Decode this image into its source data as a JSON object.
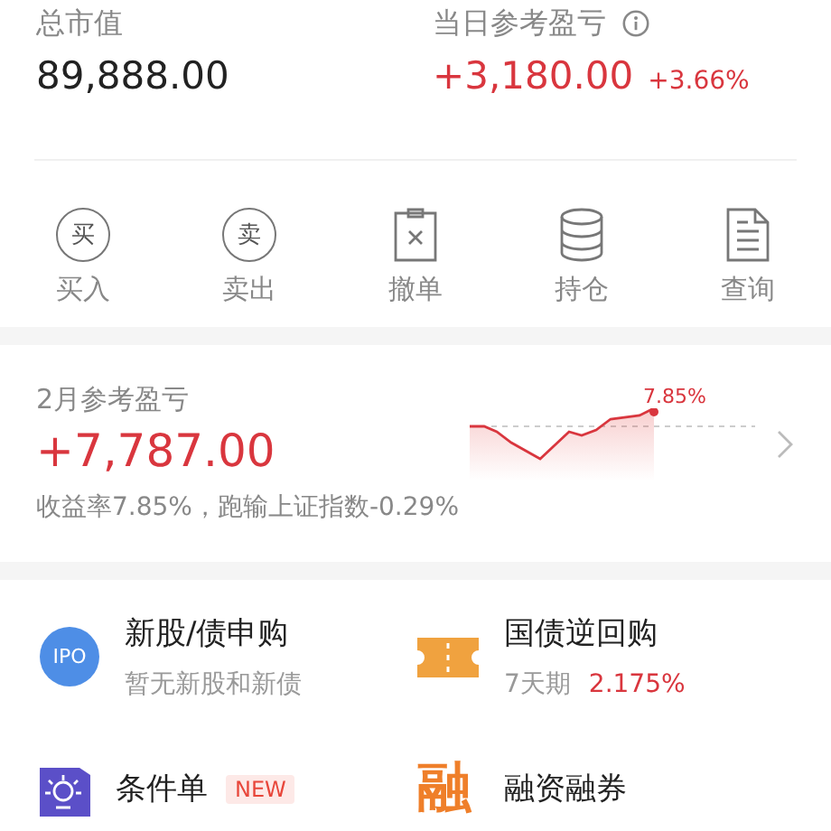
{
  "summary": {
    "total_label": "总市值",
    "total_value": "89,888.00",
    "daily_label": "当日参考盈亏",
    "daily_value": "+3,180.00",
    "daily_pct": "+3.66%"
  },
  "actions": [
    {
      "kind": "buy",
      "label": "买入",
      "glyph": "买"
    },
    {
      "kind": "sell",
      "label": "卖出",
      "glyph": "卖"
    },
    {
      "kind": "cancel",
      "label": "撤单"
    },
    {
      "kind": "holdings",
      "label": "持仓"
    },
    {
      "kind": "query",
      "label": "查询"
    }
  ],
  "monthly": {
    "title": "2月参考盈亏",
    "value": "+7,787.00",
    "subtitle": "收益率7.85%，跑输上证指数-0.29%",
    "chart_label": "7.85%"
  },
  "services": [
    {
      "kind": "ipo",
      "icon_text": "IPO",
      "title": "新股/债申购",
      "subtitle": "暂无新股和新债"
    },
    {
      "kind": "repo",
      "title": "国债逆回购",
      "subtitle": "7天期",
      "rate": "2.175%"
    },
    {
      "kind": "conditional",
      "title": "条件单",
      "badge": "NEW"
    },
    {
      "kind": "margin",
      "icon_text": "融",
      "title": "融资融券"
    }
  ]
}
